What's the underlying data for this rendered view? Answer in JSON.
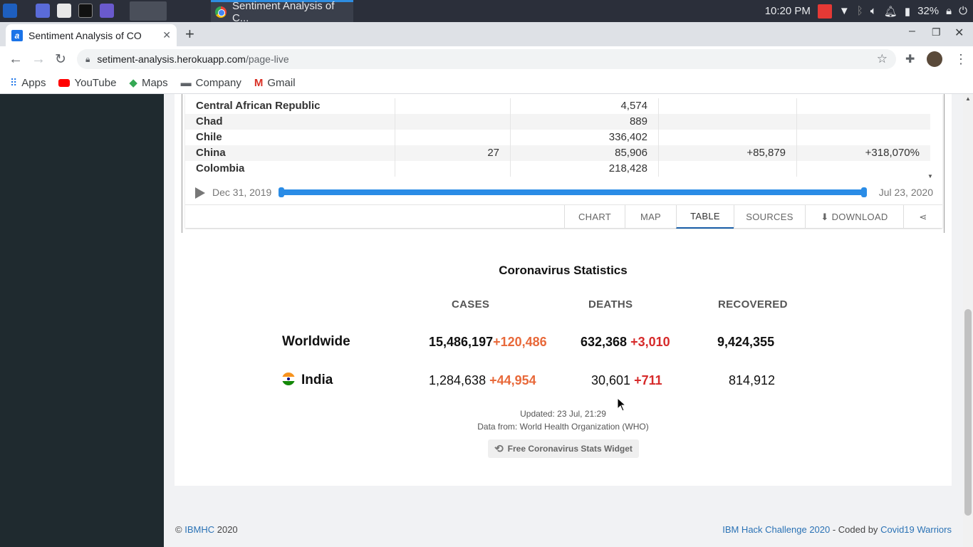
{
  "os": {
    "clock": "10:20 PM",
    "battery": "32%",
    "task_title": "Sentiment Analysis of C..."
  },
  "browser": {
    "tab_title": "Sentiment Analysis of CO",
    "url_host": "setiment-analysis.herokuapp.com",
    "url_path": "/page-live",
    "bookmarks": [
      "Apps",
      "YouTube",
      "Maps",
      "Company",
      "Gmail"
    ]
  },
  "table": {
    "rows": [
      {
        "country": "Central African Republic",
        "c2": "",
        "c3": "4,574",
        "c4": "",
        "c5": ""
      },
      {
        "country": "Chad",
        "c2": "",
        "c3": "889",
        "c4": "",
        "c5": ""
      },
      {
        "country": "Chile",
        "c2": "",
        "c3": "336,402",
        "c4": "",
        "c5": ""
      },
      {
        "country": "China",
        "c2": "27",
        "c3": "85,906",
        "c4": "+85,879",
        "c5": "+318,070%"
      },
      {
        "country": "Colombia",
        "c2": "",
        "c3": "218,428",
        "c4": "",
        "c5": ""
      }
    ]
  },
  "timeline": {
    "start": "Dec 31, 2019",
    "end": "Jul 23, 2020"
  },
  "controls": {
    "chart": "CHART",
    "map": "MAP",
    "table": "TABLE",
    "sources": "SOURCES",
    "download": "DOWNLOAD"
  },
  "stats": {
    "title": "Coronavirus Statistics",
    "headers": [
      "CASES",
      "DEATHS",
      "RECOVERED"
    ],
    "worldwide": {
      "label": "Worldwide",
      "cases": "15,486,197",
      "cases_new": "+120,486",
      "deaths": "632,368",
      "deaths_new": "+3,010",
      "recovered": "9,424,355"
    },
    "india": {
      "label": "India",
      "cases": "1,284,638",
      "cases_new": "+44,954",
      "deaths": "30,601",
      "deaths_new": "+711",
      "recovered": "814,912"
    },
    "updated": "Updated: 23 Jul, 21:29",
    "source": "Data from: World Health Organization (WHO)",
    "widget": "Free Coronavirus Stats Widget"
  },
  "footer": {
    "copyright": "©",
    "ibmhc": "IBMHC",
    "year": "2020",
    "hack": "IBM Hack Challenge 2020",
    "coded_by": " - Coded by ",
    "team": "Covid19 Warriors"
  }
}
